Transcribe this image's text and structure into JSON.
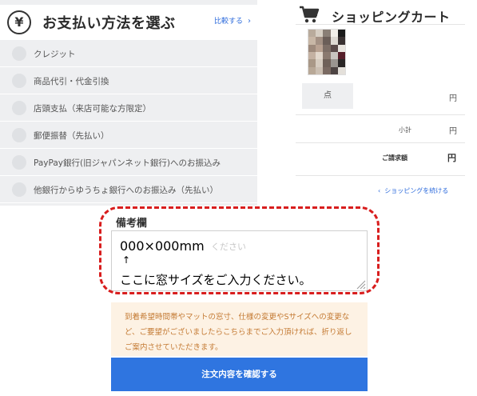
{
  "payment": {
    "icon": "yen-icon",
    "yen_symbol": "¥",
    "title": "お支払い方法を選ぶ",
    "compare_label": "比較する",
    "compare_chevron": "›",
    "options": [
      {
        "label": "クレジット"
      },
      {
        "label": "商品代引・代金引換"
      },
      {
        "label": "店頭支払（来店可能な方限定）"
      },
      {
        "label": "郵便振替（先払い）"
      },
      {
        "label": "PayPay銀行(旧ジャパンネット銀行)へのお振込み"
      },
      {
        "label": "他銀行からゆうちょ銀行へのお振込み（先払い）"
      }
    ]
  },
  "cart": {
    "icon": "shopping-cart-icon",
    "title": "ショッピングカート",
    "thumbnail": "fabric-swatches-thumbnail",
    "qty_unit": "点",
    "item_yen": "円",
    "subtotal_label": "小計",
    "subtotal_yen": "円",
    "total_label": "ご請求額",
    "total_yen": "円",
    "continue_chevron": "‹",
    "continue_label": "ショッピングを続ける"
  },
  "notes": {
    "label": "備考欄",
    "placeholder": "ください",
    "line1": "000×000mm",
    "line2": "↑",
    "line3": "ここに窓サイズをご入力ください。"
  },
  "info": {
    "text": "到着希望時間帯やマットの窓寸、仕様の変更やSサイズへの変更など、ご要望がございましたらこちらまでご入力頂ければ、折り返しご案内させていただきます。"
  },
  "confirm": {
    "label": "注文内容を確認する"
  },
  "colors": {
    "accent_blue": "#2f75e0",
    "link_blue": "#2d6bdc",
    "highlight_red": "#d81e1e",
    "info_bg": "#fdf2e4",
    "info_text": "#c47a33",
    "panel_gray": "#eeeff1"
  }
}
